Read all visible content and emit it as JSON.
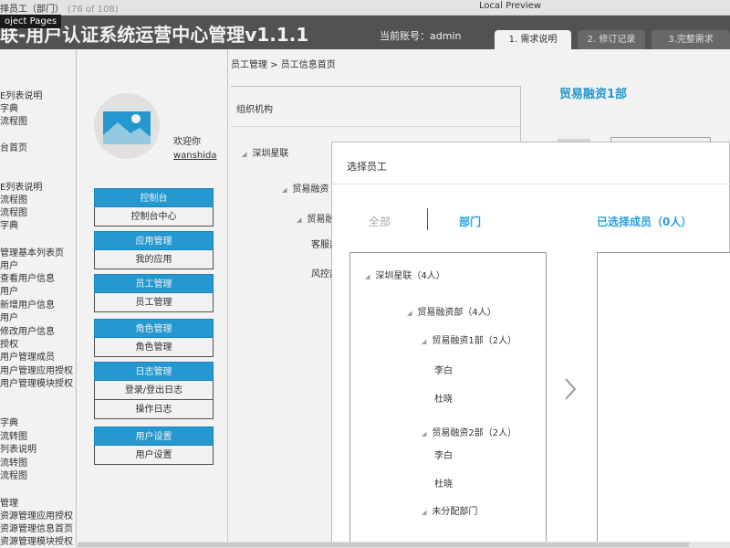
{
  "topbar": {
    "page_crumb": "择员工（部门）",
    "page_count": "(76 of 108)",
    "preview_label": "Local Preview",
    "tooltip": "oject Pages"
  },
  "header": {
    "title": "联-用户认证系统运营中心管理v1.1.1",
    "account": "当前账号：admin",
    "tabs": [
      {
        "label": "1. 需求说明"
      },
      {
        "label": "2. 修订记录"
      },
      {
        "label": "3.完整需求"
      }
    ]
  },
  "left_nav": {
    "items": [
      "E列表说明",
      "字典",
      "流程图",
      "台首页",
      "",
      "E列表说明",
      "流程图",
      "流程图",
      "字典",
      "管理基本列表页",
      "用户",
      "查看用户信息",
      "用户",
      "新增用户信息",
      "用户",
      "修改用户信息",
      "授权",
      "用户管理成员",
      "用户管理应用授权",
      "用户管理模块授权",
      "",
      "字典",
      "流转图",
      "列表说明",
      "流转图",
      "流程图",
      "管理",
      "资源管理应用授权",
      "资源管理信息首页",
      "资源管理模块授权"
    ]
  },
  "sidebar": {
    "welcome": "欢迎你",
    "username": "wanshida",
    "groups": [
      {
        "header": "控制台",
        "items": [
          "控制台中心"
        ]
      },
      {
        "header": "应用管理",
        "items": [
          "我的应用"
        ]
      },
      {
        "header": "员工管理",
        "items": [
          "员工管理"
        ]
      },
      {
        "header": "角色管理",
        "items": [
          "角色管理"
        ]
      },
      {
        "header": "日志管理",
        "items": [
          "登录/登出日志",
          "操作日志"
        ]
      },
      {
        "header": "用户设置",
        "items": [
          "用户设置"
        ]
      }
    ]
  },
  "main": {
    "breadcrumb": "员工管理  >   员工信息首页",
    "org_title": "组织机构",
    "org_tree": [
      "深圳星联",
      "贸易融资",
      "贸易融",
      "客服部",
      "风控部"
    ],
    "dept_title": "贸易融资1部"
  },
  "modal": {
    "title": "选择员工",
    "tab_all": "全部",
    "tab_dept": "部门",
    "selected_label": "已选择成员（0人）",
    "tree": [
      "深圳星联（4人）",
      "贸易融资部（4人）",
      "贸易融资1部（2人）",
      "李白",
      "杜晓",
      "贸易融资2部（2人）",
      "李白",
      "杜晓",
      "未分配部门"
    ]
  },
  "colors": {
    "accent": "#29a1dc",
    "header_bg": "#575757"
  }
}
